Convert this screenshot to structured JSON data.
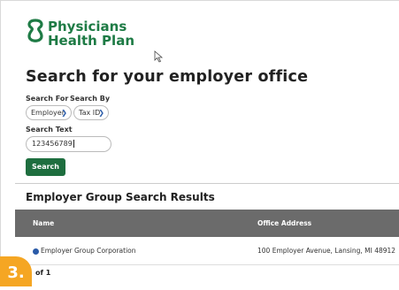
{
  "brand": {
    "line1": "Physicians",
    "line2": "Health Plan",
    "color": "#1e7b45"
  },
  "page_title": "Search for your employer office",
  "search_for": {
    "label": "Search For",
    "value": "Employer"
  },
  "search_by": {
    "label": "Search By",
    "value": "Tax ID"
  },
  "search_text": {
    "label": "Search Text",
    "value": "123456789"
  },
  "search_button": "Search",
  "results": {
    "title": "Employer Group Search Results",
    "columns": [
      "Name",
      "Office Address"
    ],
    "rows": [
      {
        "name": "Employer Group Corporation",
        "address": "100 Employer Avenue, Lansing, MI 48912"
      }
    ]
  },
  "pager": "of 1",
  "step_badge": "3.",
  "colors": {
    "accent": "#1e6e3f",
    "badge": "#f5a623",
    "header": "#6b6b6b"
  }
}
